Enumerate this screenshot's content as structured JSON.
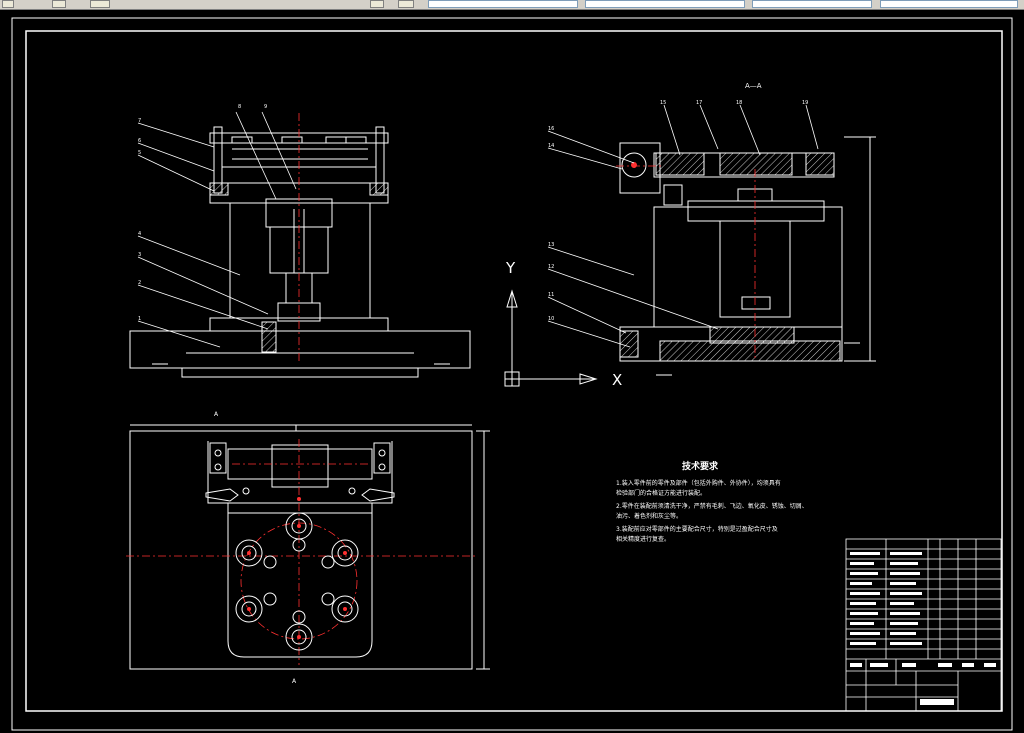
{
  "toolbar": {
    "icons": [
      "file-icon",
      "layer-icon",
      "color-icon",
      "zoom-icon",
      "properties-icon"
    ],
    "combos": [
      "",
      "",
      "",
      ""
    ]
  },
  "drawing": {
    "section_label": "A—A",
    "view_marker_top": "A",
    "view_marker_bottom": "A",
    "axis_x": "X",
    "axis_y": "Y",
    "front_callouts": [
      "7",
      "6",
      "5",
      "4",
      "3",
      "2",
      "1",
      "8",
      "9"
    ],
    "section_callouts": [
      "16",
      "14",
      "13",
      "12",
      "11",
      "10",
      "15",
      "17",
      "18",
      "19"
    ],
    "colors": {
      "line": "#ffffff",
      "center": "#ff2020",
      "dim": "#ffffff",
      "hatch": "#ffffff",
      "red": "#ff3030"
    }
  },
  "notes": {
    "title": "技术要求",
    "lines": [
      "1.装入零件前的零件及部件（包括外购件、外协件），均须具有",
      "检验部门的合格证方能进行装配。",
      "2.零件在装配前须清洗干净，严禁有毛刺、飞边、氧化皮、锈蚀、切屑、",
      "油污、着色剂和灰尘等。",
      "3.装配前应对零部件的主要配合尺寸，特别是过盈配合尺寸及",
      "相关精度进行复查。"
    ]
  }
}
